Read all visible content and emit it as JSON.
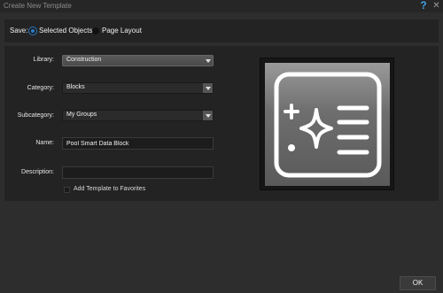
{
  "window": {
    "title": "Create New Template",
    "help_icon": "question-mark-icon",
    "close_icon": "close-icon"
  },
  "save": {
    "label": "Save:",
    "options": [
      {
        "label": "Selected Objects",
        "selected": true
      },
      {
        "label": "Page Layout",
        "selected": false
      }
    ]
  },
  "form": {
    "library": {
      "label": "Library:",
      "value": "Construction"
    },
    "category": {
      "label": "Category:",
      "value": "Blocks"
    },
    "subcategory": {
      "label": "Subcategory:",
      "value": "My Groups"
    },
    "name": {
      "label": "Name:",
      "value": "Pool Smart Data Block"
    },
    "description": {
      "label": "Description:",
      "value": ""
    },
    "favorites": {
      "label": "Add Template to Favorites",
      "checked": false
    }
  },
  "preview": {
    "icon": "smart-data-sparkle-list-icon"
  },
  "footer": {
    "ok_label": "OK"
  },
  "colors": {
    "accent": "#2b7cc4",
    "help": "#3fa2e6",
    "background": "#2d2d2d",
    "panel": "#232323"
  }
}
